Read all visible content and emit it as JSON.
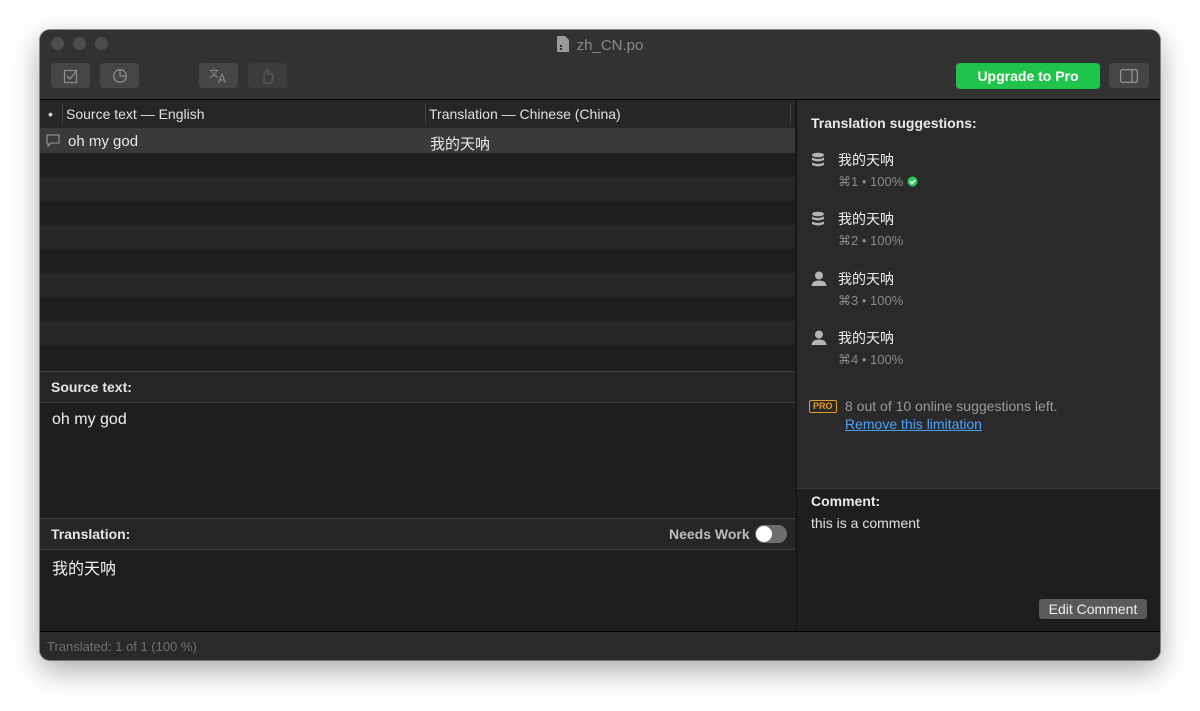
{
  "window": {
    "title": "zh_CN.po"
  },
  "toolbar": {
    "upgrade_label": "Upgrade to Pro",
    "icons": [
      "validate-icon",
      "statistics-icon",
      "translate-icon",
      "pretranslate-icon",
      "sidebar-toggle-icon"
    ]
  },
  "list": {
    "bullet": "•",
    "col_source": "Source text — English",
    "col_translation": "Translation — Chinese (China)",
    "rows": [
      {
        "source": "oh my god",
        "translation": "我的天呐"
      }
    ]
  },
  "source_panel": {
    "label": "Source text:",
    "text": "oh my god"
  },
  "translation_panel": {
    "label": "Translation:",
    "needs_work_label": "Needs Work",
    "needs_work_on": false,
    "text": "我的天呐"
  },
  "suggestions": {
    "title": "Translation suggestions:",
    "items": [
      {
        "text": "我的天呐",
        "meta": "⌘1 • 100%",
        "icon": "database-icon",
        "verified": true
      },
      {
        "text": "我的天呐",
        "meta": "⌘2 • 100%",
        "icon": "database-icon",
        "verified": false
      },
      {
        "text": "我的天呐",
        "meta": "⌘3 • 100%",
        "icon": "person-icon",
        "verified": false
      },
      {
        "text": "我的天呐",
        "meta": "⌘4 • 100%",
        "icon": "person-icon",
        "verified": false
      }
    ],
    "pro_badge": "PRO",
    "pro_text": "8 out of 10 online suggestions left.",
    "pro_link": "Remove this limitation"
  },
  "comment": {
    "label": "Comment:",
    "text": "this is a comment",
    "edit_label": "Edit Comment"
  },
  "status": {
    "text": "Translated: 1 of 1 (100 %)"
  },
  "colors": {
    "accent_green": "#21c44a",
    "link_blue": "#4aa3ff",
    "pro_orange": "#e59a2a"
  }
}
